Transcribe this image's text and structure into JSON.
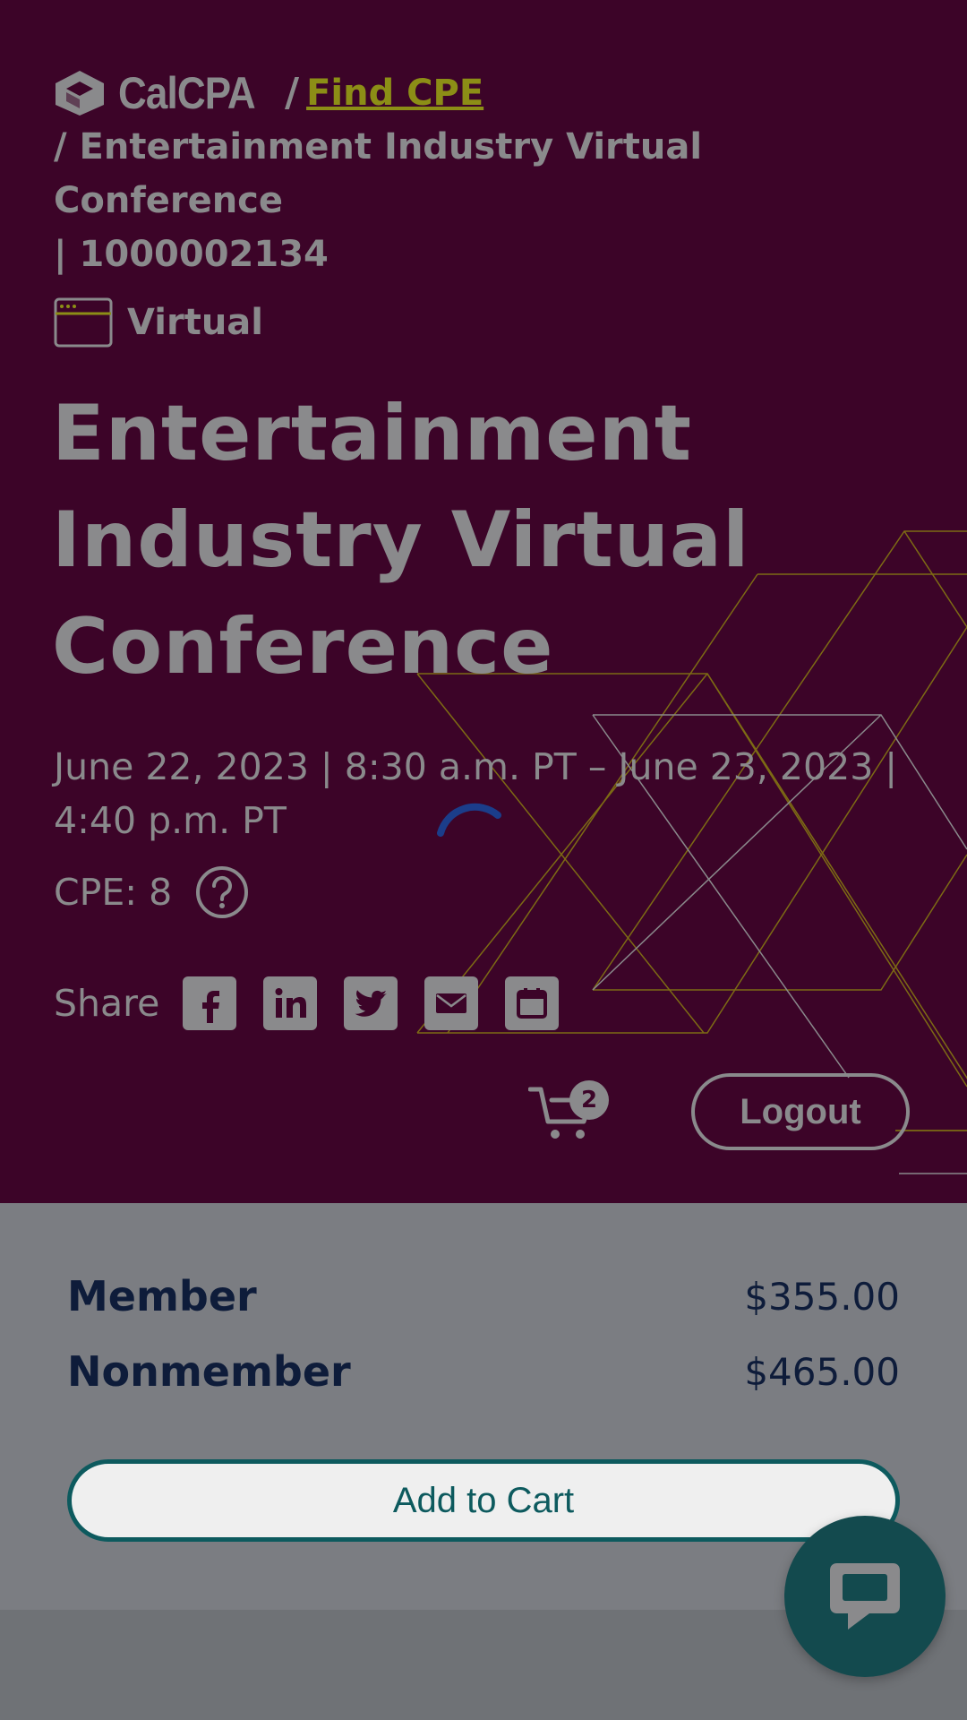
{
  "header": {
    "brand": "CalCPA",
    "separator": "/",
    "find_link": "Find CPE",
    "breadcrumb_line1": "/ Entertainment Industry Virtual Conference",
    "breadcrumb_line2": "| 1000002134"
  },
  "event": {
    "format": "Virtual",
    "title": "Entertainment Industry Virtual Conference",
    "dates_line1": "June 22, 2023 | 8:30 a.m. PT – June 23, 2023 |",
    "dates_line2": "4:40 p.m. PT",
    "cpe": "CPE: 8"
  },
  "share": {
    "label": "Share",
    "icons": [
      "facebook-icon",
      "linkedin-icon",
      "twitter-icon",
      "email-icon",
      "calendar-icon"
    ]
  },
  "cart": {
    "count": "2"
  },
  "auth": {
    "logout_label": "Logout"
  },
  "pricing": {
    "rows": [
      {
        "name": "Member",
        "price": "$355.00"
      },
      {
        "name": "Nonmember",
        "price": "$465.00"
      }
    ],
    "add_to_cart_label": "Add to Cart"
  },
  "colors": {
    "hero_bg": "#3c0428",
    "link": "#8c8e16",
    "accent_teal": "#0d5a5e",
    "chat_bg": "#134a4e",
    "overlay_text": "#8a8a8c"
  }
}
